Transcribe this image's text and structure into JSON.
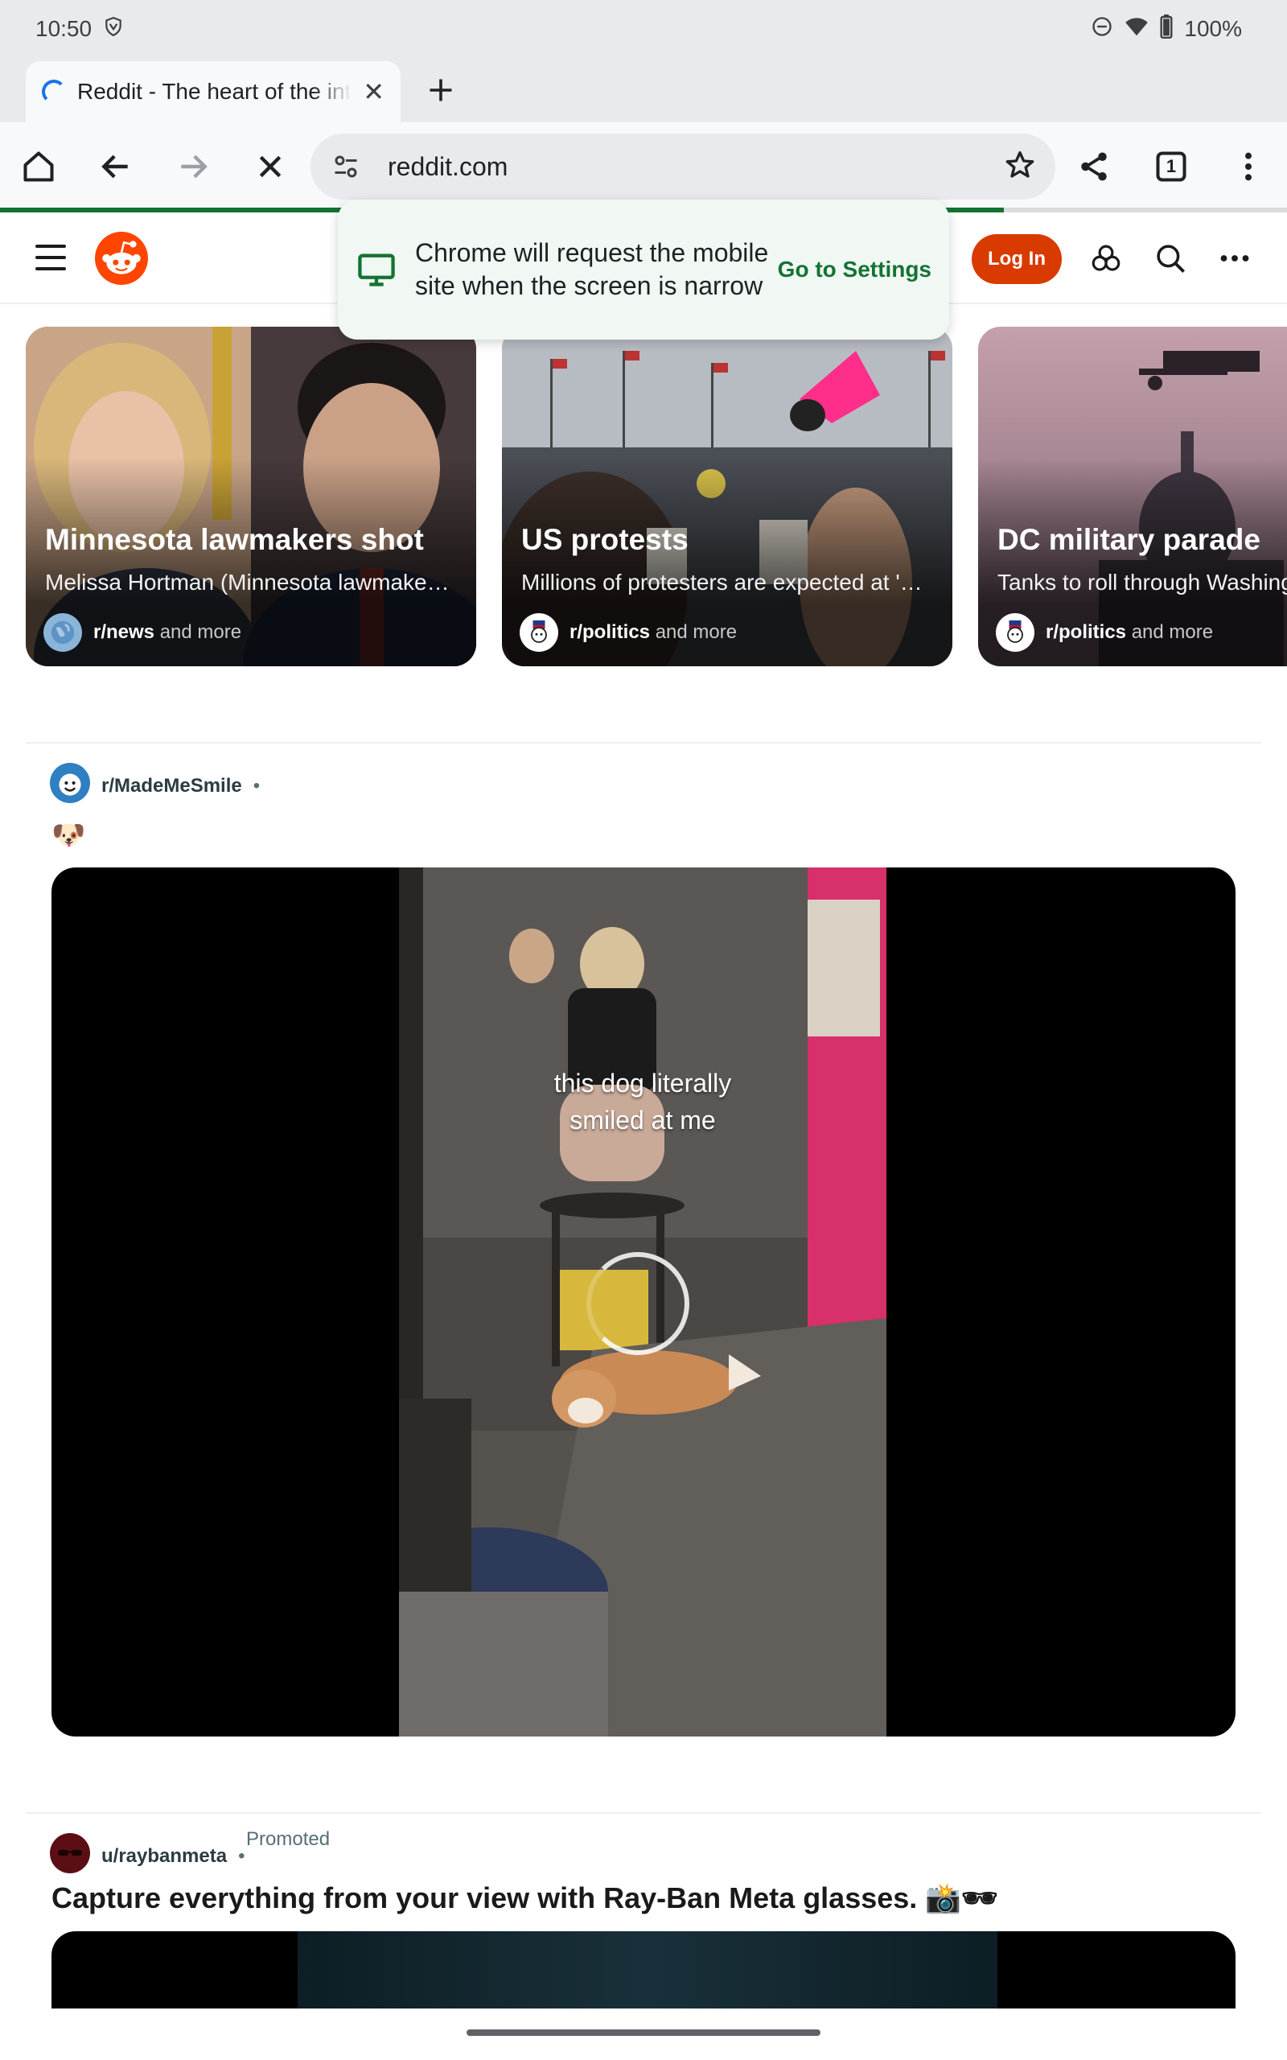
{
  "status_bar": {
    "time": "10:50",
    "battery": "100%"
  },
  "tab": {
    "title": "Reddit - The heart of the internet"
  },
  "toolbar": {
    "url": "reddit.com",
    "tab_count": "1"
  },
  "popup": {
    "message": "Chrome will request the mobile site when the screen is narrow",
    "action": "Go to Settings"
  },
  "header": {
    "login_label": "Log In"
  },
  "cards": [
    {
      "title": "Minnesota lawmakers shot",
      "subtitle": "Melissa Hortman (Minnesota lawmaker…",
      "community": "r/news",
      "more": "and more"
    },
    {
      "title": "US protests",
      "subtitle": "Millions of protesters are expected at '…",
      "community": "r/politics",
      "more": "and more"
    },
    {
      "title": "DC military parade",
      "subtitle": "Tanks to roll through Washington",
      "community": "r/politics",
      "more": "and more"
    }
  ],
  "post1": {
    "subreddit": "r/MadeMeSmile",
    "separator": "•",
    "flair_emoji": "🐶",
    "caption_line1": "this dog literally",
    "caption_line2": "smiled at me"
  },
  "post2": {
    "user": "u/raybanmeta",
    "separator": "•",
    "promoted": "Promoted",
    "title": "Capture everything from your view with Ray-Ban Meta glasses. 📸🕶"
  },
  "colors": {
    "reddit_orange": "#ff4500",
    "login_bg": "#d93a00",
    "chrome_green": "#137333",
    "popup_bg": "#f1f8f3"
  },
  "page_load_progress": 0.78
}
